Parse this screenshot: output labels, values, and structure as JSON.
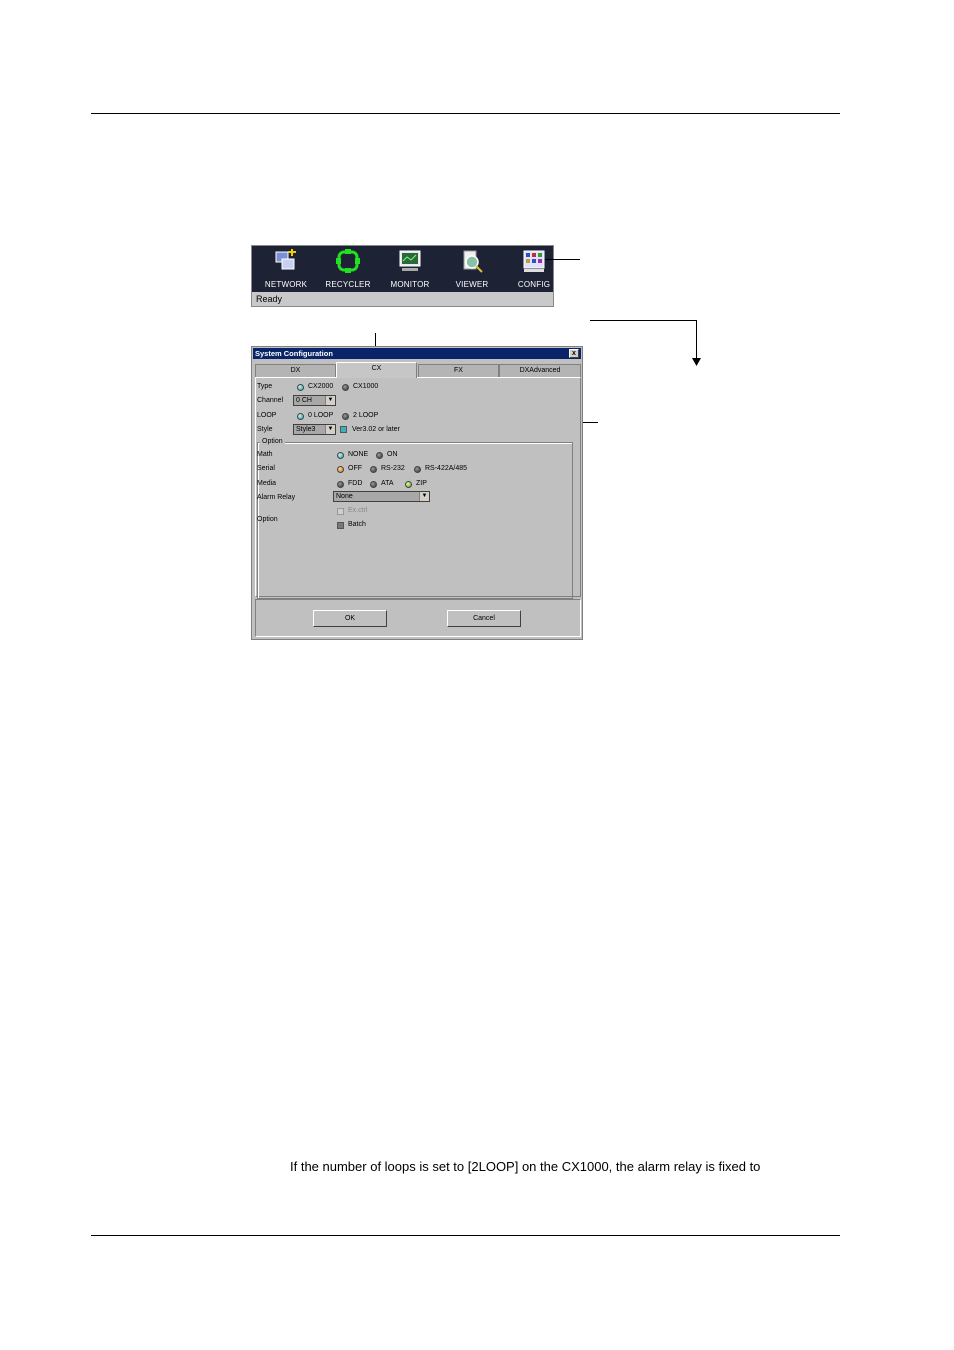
{
  "toolbar": {
    "buttons": [
      {
        "label": "NETWORK",
        "icon": "network-icon"
      },
      {
        "label": "RECYCLER",
        "icon": "recycler-icon"
      },
      {
        "label": "MONITOR",
        "icon": "monitor-icon"
      },
      {
        "label": "VIEWER",
        "icon": "viewer-icon"
      },
      {
        "label": "CONFIG",
        "icon": "config-icon"
      }
    ],
    "status": "Ready"
  },
  "dialog": {
    "title": "System Configuration",
    "close_label": "x",
    "tabs": [
      "DX",
      "CX",
      "FX",
      "DXAdvanced"
    ],
    "active_tab": "CX",
    "type": {
      "label": "Type",
      "options": [
        "CX2000",
        "CX1000"
      ],
      "selected": "CX2000"
    },
    "channel": {
      "label": "Channel",
      "value": "0 CH"
    },
    "loop": {
      "label": "LOOP",
      "options": [
        "0 LOOP",
        "2 LOOP"
      ],
      "selected": "0 LOOP"
    },
    "style": {
      "label": "Style",
      "value": "Style3",
      "checkbox_label": "Ver3.02 or later",
      "checked": true
    },
    "option_group": {
      "title": "Option",
      "math": {
        "label": "Math",
        "options": [
          "NONE",
          "ON"
        ],
        "selected": "NONE"
      },
      "serial": {
        "label": "Serial",
        "options": [
          "OFF",
          "RS-232",
          "RS-422A/485"
        ],
        "selected": "OFF"
      },
      "media": {
        "label": "Media",
        "options": [
          "FDD",
          "ATA",
          "ZIP"
        ],
        "selected": "ZIP"
      },
      "alarm_relay": {
        "label": "Alarm Relay",
        "value": "None"
      },
      "option": {
        "label": "Option",
        "checkboxes": [
          {
            "label": "Ex.ctrl",
            "enabled": false,
            "checked": false
          },
          {
            "label": "Batch",
            "enabled": true,
            "checked": false
          }
        ]
      }
    },
    "ok_label": "OK",
    "cancel_label": "Cancel"
  },
  "body_text": "If the number of loops is set to [2LOOP] on the CX1000, the alarm relay is fixed to"
}
